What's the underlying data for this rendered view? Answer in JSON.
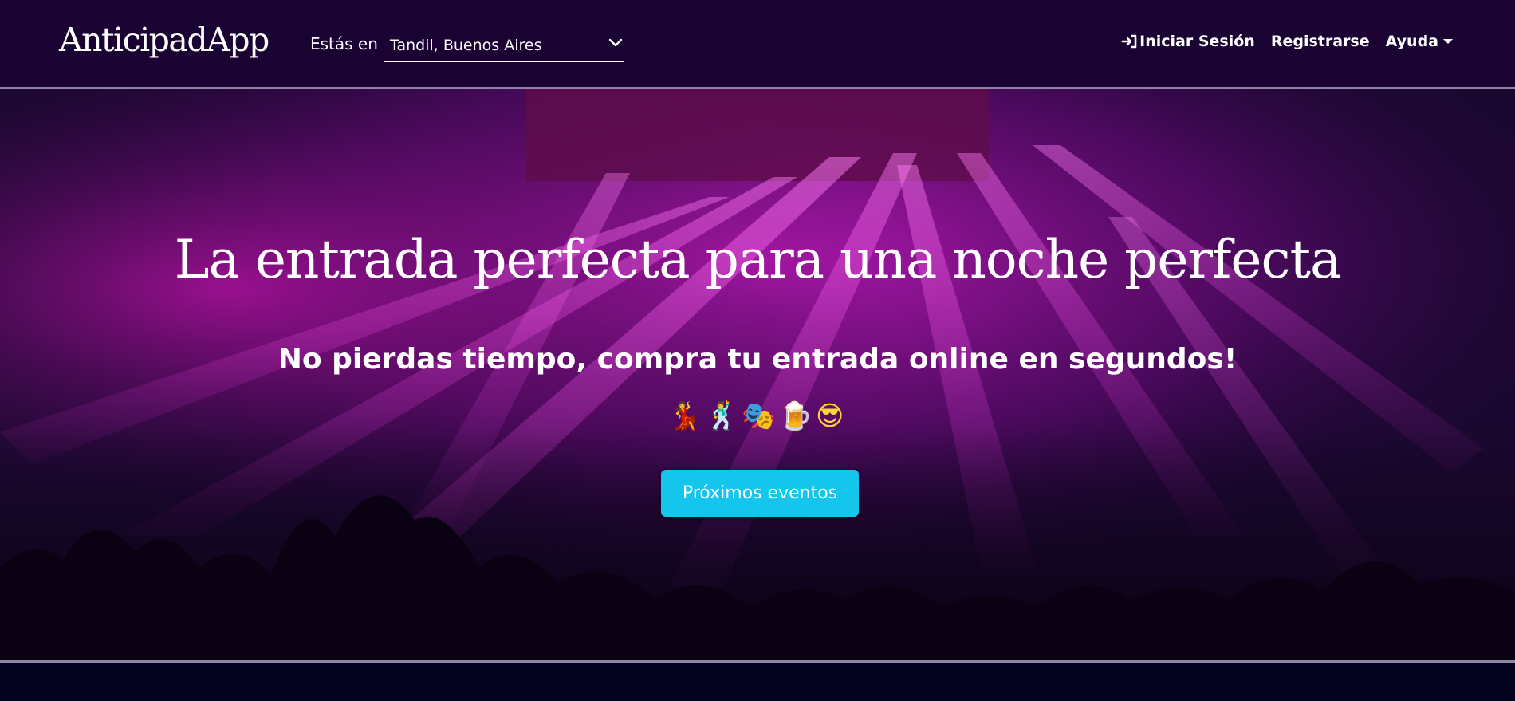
{
  "header": {
    "brand": "AnticipadApp",
    "location_label": "Estás en",
    "location_value": "Tandil, Buenos Aires",
    "login_label": "Iniciar Sesión",
    "register_label": "Registrarse",
    "help_label": "Ayuda"
  },
  "hero": {
    "title": "La entrada perfecta para una noche perfecta",
    "subtitle": "No pierdas tiempo, compra tu entrada online en segundos!",
    "emojis": "💃🕺🎭🍺😎",
    "cta_label": "Próximos eventos"
  },
  "colors": {
    "navbar": "#1a0233",
    "accent": "#14c6ec",
    "page_background": "#05031f"
  },
  "icons": [
    "login-icon",
    "chevron-down-icon",
    "caret-down-icon"
  ]
}
